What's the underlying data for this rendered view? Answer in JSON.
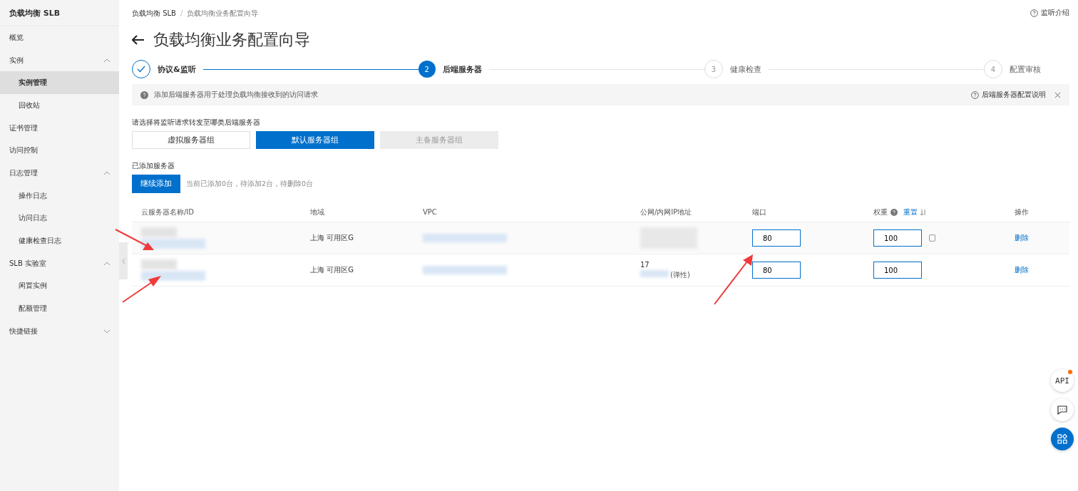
{
  "sidebar": {
    "title": "负载均衡 SLB",
    "items": [
      {
        "label": "概览",
        "kind": "link",
        "selected": false
      },
      {
        "label": "实例",
        "kind": "group",
        "expanded": true,
        "children": [
          {
            "label": "实例管理",
            "selected": true
          },
          {
            "label": "回收站",
            "selected": false
          }
        ]
      },
      {
        "label": "证书管理",
        "kind": "link",
        "selected": false
      },
      {
        "label": "访问控制",
        "kind": "link",
        "selected": false
      },
      {
        "label": "日志管理",
        "kind": "group",
        "expanded": true,
        "children": [
          {
            "label": "操作日志",
            "selected": false
          },
          {
            "label": "访问日志",
            "selected": false
          },
          {
            "label": "健康检查日志",
            "selected": false
          }
        ]
      },
      {
        "label": "SLB 实验室",
        "kind": "group",
        "expanded": true,
        "children": [
          {
            "label": "闲置实例",
            "selected": false
          },
          {
            "label": "配额管理",
            "selected": false
          }
        ]
      },
      {
        "label": "快捷链接",
        "kind": "group",
        "expanded": false
      }
    ]
  },
  "breadcrumb": [
    "负载均衡 SLB",
    "负载均衡业务配置向导"
  ],
  "breadcrumb_separator": "/",
  "help_link": "监听介绍",
  "title": "负载均衡业务配置向导",
  "steps": [
    {
      "label": "协议&监听",
      "kind": "done"
    },
    {
      "label": "后端服务器",
      "number": "2",
      "kind": "active"
    },
    {
      "label": "健康检查",
      "number": "3",
      "kind": "pending"
    },
    {
      "label": "配置审核",
      "number": "4",
      "kind": "pending"
    }
  ],
  "notice": {
    "text": "添加后端服务器用于处理负载均衡接收到的访问请求",
    "link": "后端服务器配置说明"
  },
  "server_type": {
    "label": "请选择将监听请求转发至哪类后端服务器",
    "options": [
      {
        "label": "虚拟服务器组",
        "selected": false,
        "disabled": false
      },
      {
        "label": "默认服务器组",
        "selected": true,
        "disabled": false
      },
      {
        "label": "主备服务器组",
        "selected": false,
        "disabled": true
      }
    ]
  },
  "added": {
    "label": "已添加服务器",
    "button": "继续添加",
    "summary": "当前已添加0台，待添加2台，待删除0台"
  },
  "table": {
    "columns": [
      "云服务器名称/ID",
      "地域",
      "VPC",
      "公网/内网IP地址",
      "端口",
      "权重",
      "操作"
    ],
    "weight_reset": "重置",
    "rows": [
      {
        "region": "上海 可用区G",
        "port": "80",
        "weight": "100",
        "action": "删除"
      },
      {
        "region": "上海 可用区G",
        "ip_fragment": "17",
        "ip_note": "(弹性)",
        "port": "80",
        "weight": "100",
        "action": "删除"
      }
    ]
  },
  "float_buttons": [
    {
      "kind": "api",
      "label": "API",
      "badge": true
    },
    {
      "kind": "chat",
      "badge": false
    },
    {
      "kind": "apps",
      "badge": false
    }
  ]
}
